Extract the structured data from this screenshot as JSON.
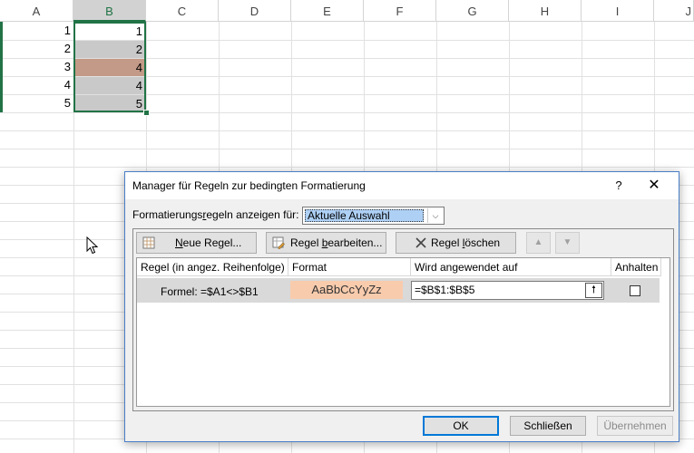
{
  "sheet": {
    "columns": [
      "A",
      "B",
      "C",
      "D",
      "E",
      "F",
      "G",
      "H",
      "I",
      "J"
    ],
    "selected_column": "B",
    "colA": [
      "1",
      "2",
      "3",
      "4",
      "5"
    ],
    "colB": [
      "1",
      "2",
      "4",
      "4",
      "5"
    ],
    "colors": {
      "highlight": "#c39a87",
      "grey": "#c9c9c9",
      "accent": "#217346"
    }
  },
  "dialog": {
    "title": "Manager für Regeln zur bedingten Formatierung",
    "help": "?",
    "close": "✕",
    "show_label_pre": "Formatierungs",
    "show_label_accel": "r",
    "show_label_post": "egeln anzeigen für:",
    "show_value": "Aktuelle Auswahl",
    "toolbar": {
      "new_rule": "Neue Regel...",
      "edit_rule": "Regel bearbeiten...",
      "delete_rule": "Regel löschen",
      "new_icon": "new-rule-icon",
      "edit_icon": "edit-rule-icon",
      "delete_icon": "delete-x-icon"
    },
    "columns": {
      "rule": "Regel (in angez. Reihenfolge)",
      "format": "Format",
      "applies": "Wird angewendet auf",
      "stop": "Anhalten"
    },
    "rule": {
      "name": "Formel: =$A1<>$B1",
      "preview": "AaBbCcYyZz",
      "applies_to": "=$B$1:$B$5",
      "stop_if_true": false
    },
    "buttons": {
      "ok": "OK",
      "close": "Schließen",
      "apply": "Übernehmen"
    }
  }
}
